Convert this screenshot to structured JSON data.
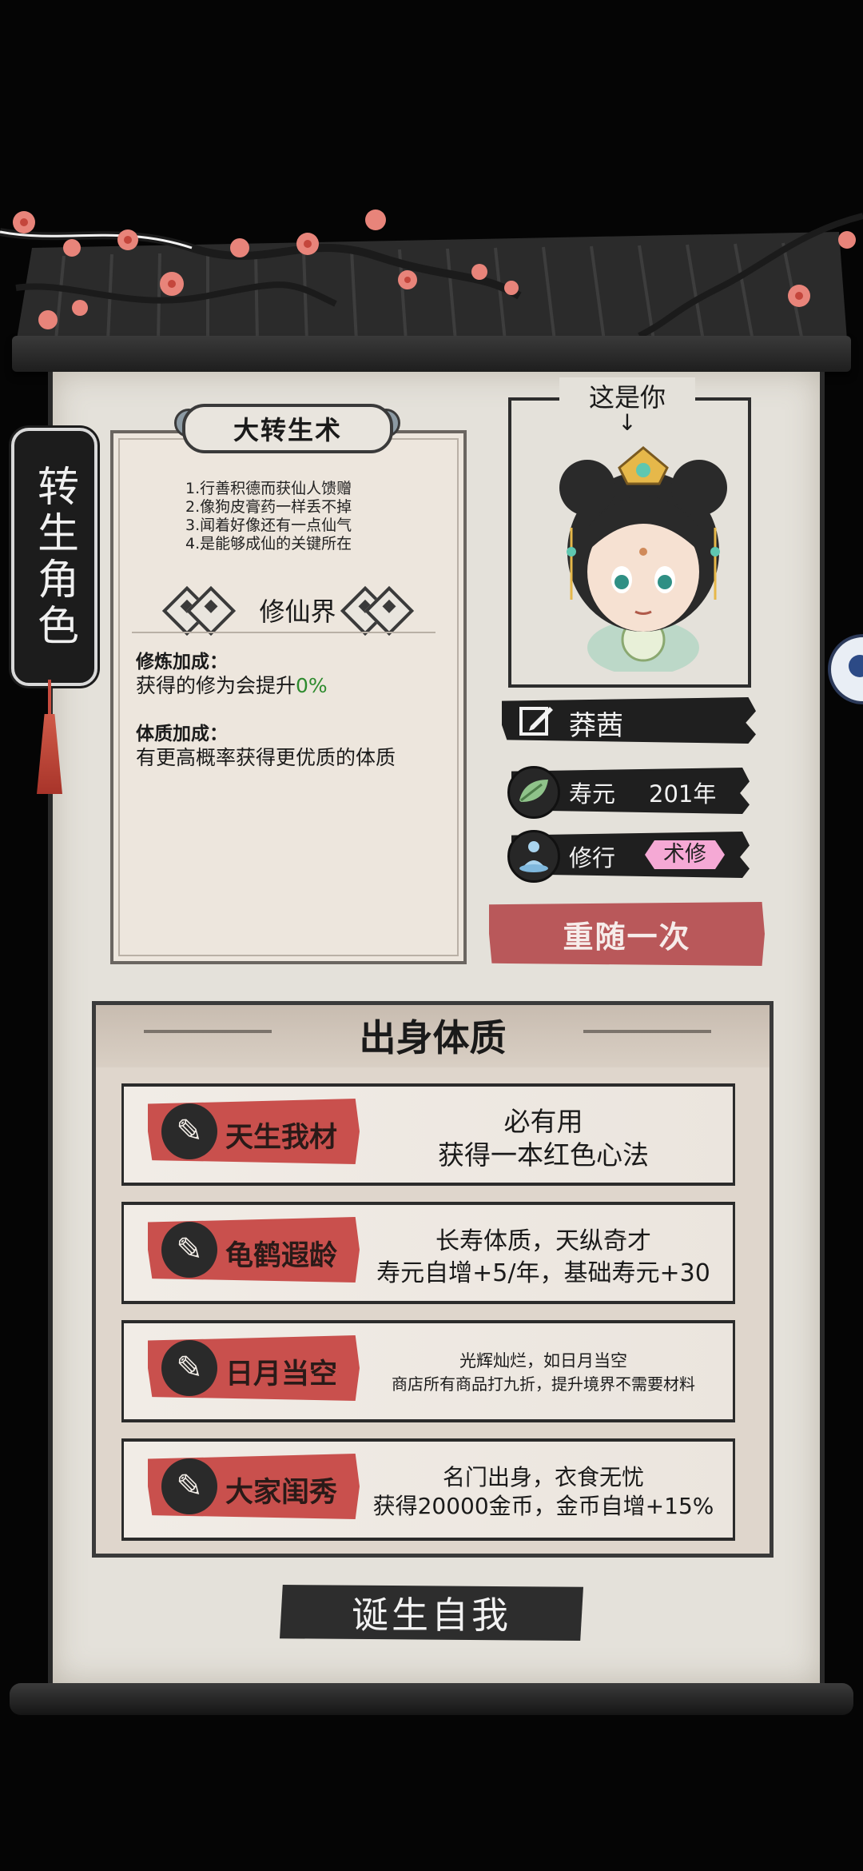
{
  "side_tab": {
    "label": "转生角色"
  },
  "info_card": {
    "title": "大转生术",
    "lines": [
      "1.行善积德而获仙人馈赠",
      "2.像狗皮膏药一样丢不掉",
      "3.闻着好像还有一点仙气",
      "4.是能够成仙的关键所在"
    ],
    "realm": "修仙界",
    "cultivation_bonus": {
      "title": "修炼加成：",
      "text": "获得的修为会提升",
      "value": "0%"
    },
    "physique_bonus": {
      "title": "体质加成：",
      "text": "有更高概率获得更优质的体质"
    }
  },
  "portrait": {
    "caption": "这是你",
    "arrow": "↓"
  },
  "character": {
    "name": "莽茜",
    "lifespan_label": "寿元",
    "lifespan_value": "201年",
    "cultivation_label": "修行",
    "cultivation_value": "术修"
  },
  "reroll_button": "重随一次",
  "origin": {
    "title": "出身体质",
    "traits": [
      {
        "name": "天生我材",
        "desc_line1": "必有用",
        "desc_line2": "获得一本红色心法"
      },
      {
        "name": "龟鹤遐龄",
        "desc_line1": "长寿体质，天纵奇才",
        "desc_line2": "寿元自增+5/年，基础寿元+30"
      },
      {
        "name": "日月当空",
        "desc_line1": "光辉灿烂，如日月当空",
        "desc_line2": "商店所有商品打九折，提升境界不需要材料"
      },
      {
        "name": "大家闺秀",
        "desc_line1": "名门出身，衣食无忧",
        "desc_line2": "获得20000金币，金币自增+15%"
      }
    ]
  },
  "birth_button": "诞生自我",
  "colors": {
    "accent_red": "#c9504d",
    "reroll_red": "#b9585a",
    "badge_pink": "#f5a9d5",
    "bonus_green": "#2e8b2e",
    "ink": "#1f1f1f"
  }
}
